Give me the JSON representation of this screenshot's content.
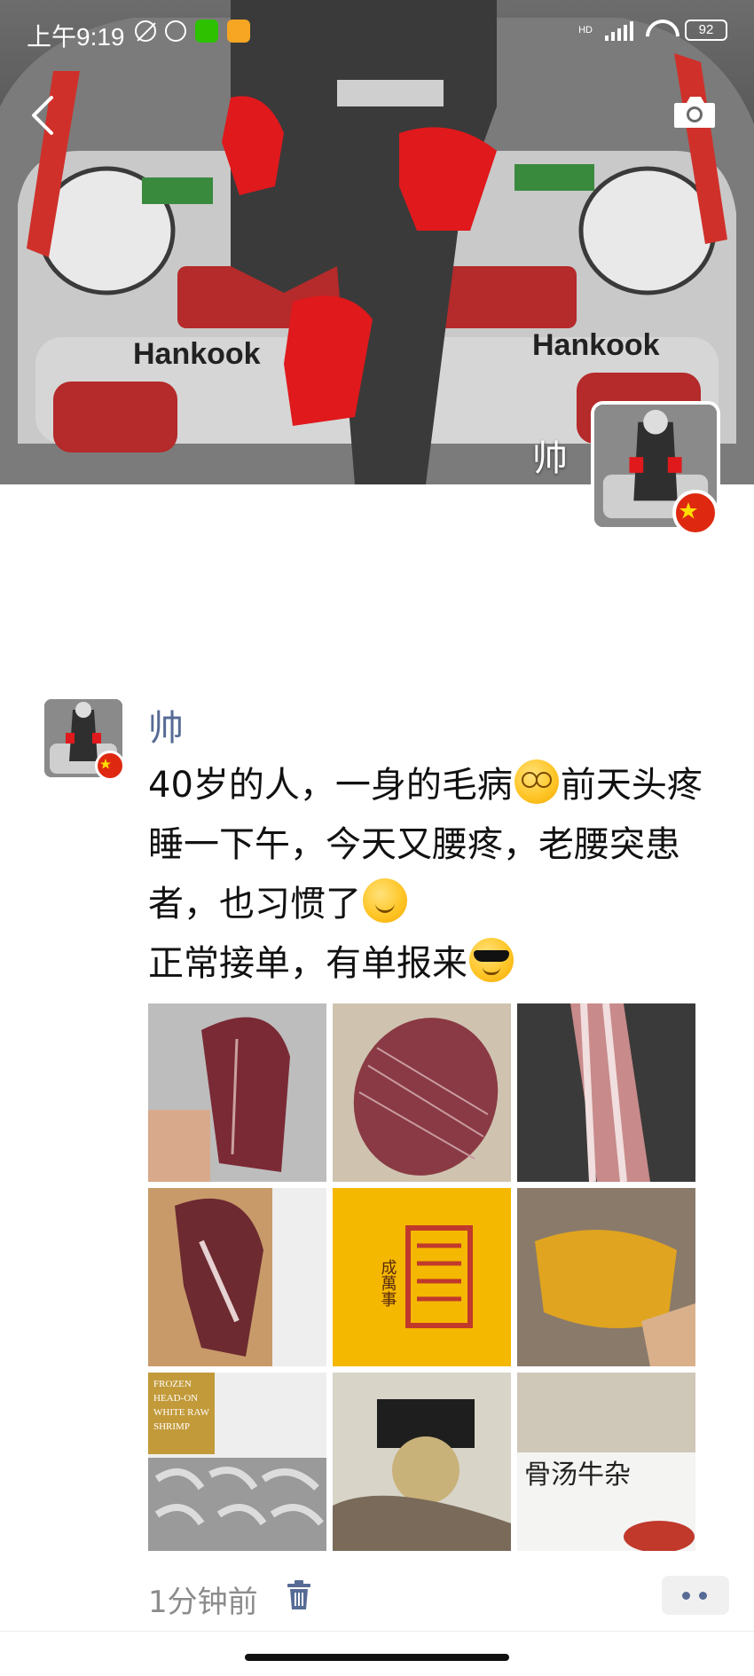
{
  "status_bar": {
    "time": "上午9:19",
    "network_label": "HD",
    "battery": "92"
  },
  "profile": {
    "name": "帅"
  },
  "post": {
    "author": "帅",
    "text_lines": [
      "40岁的人，一身的毛病",
      "前天头疼睡一下午，今天又腰疼，老腰突患者，也习惯了",
      "正常接单，有单报来"
    ],
    "time": "1分钟前",
    "photos": [
      {
        "name": "photo-beef-slice-1"
      },
      {
        "name": "photo-beef-slice-2"
      },
      {
        "name": "photo-pork-belly"
      },
      {
        "name": "photo-beef-slice-box"
      },
      {
        "name": "photo-brand-logo",
        "logo_text": "成萬事"
      },
      {
        "name": "photo-marinated-meat"
      },
      {
        "name": "photo-shrimp-box",
        "label_lines": [
          "FROZEN",
          "HEAD-ON",
          "WHITE RAW",
          "SHRIMP"
        ]
      },
      {
        "name": "photo-tripe-pack"
      },
      {
        "name": "photo-beef-offal-soup",
        "label": "骨汤牛杂"
      }
    ]
  },
  "colors": {
    "author_link": "#576b95",
    "text": "#111111",
    "time_gray": "#8c8c8c",
    "flag_red": "#de2910",
    "logo_yellow": "#f5b800"
  }
}
